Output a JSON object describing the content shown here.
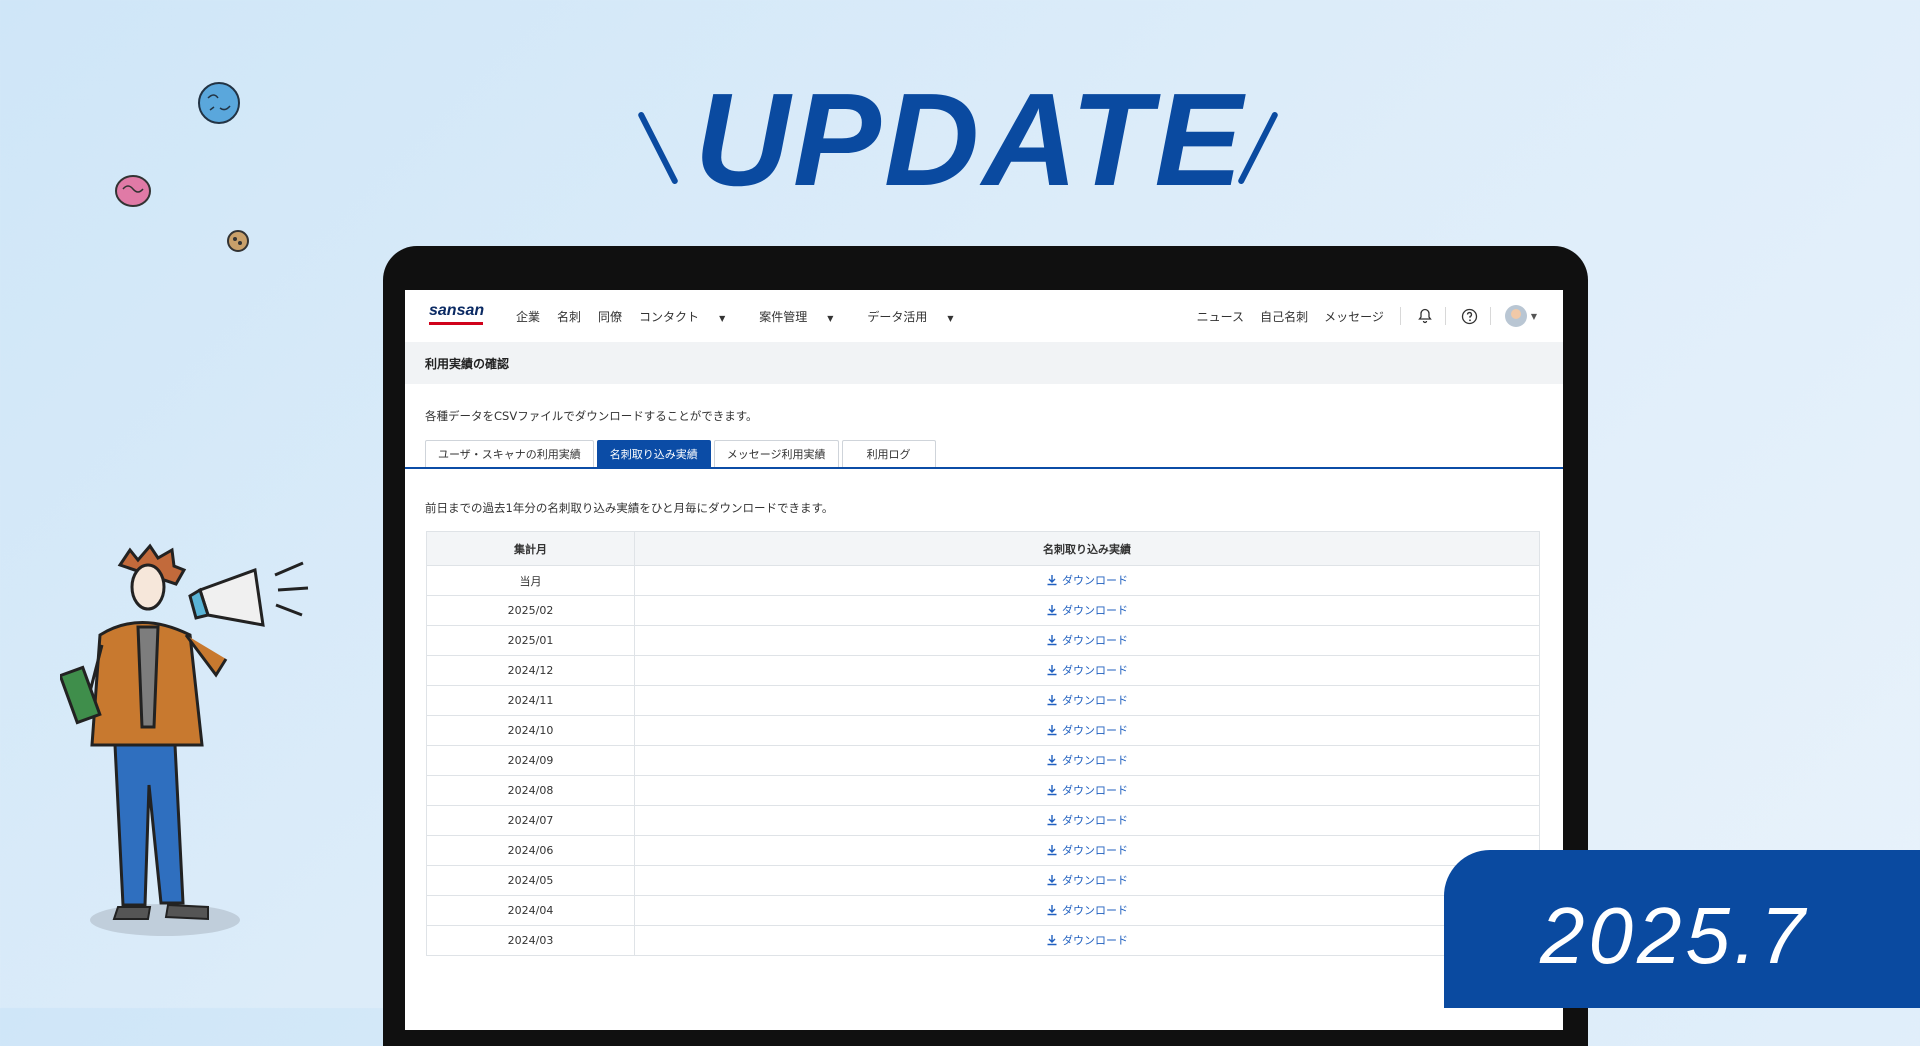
{
  "banner": {
    "headline": "UPDATE",
    "date": "2025.7"
  },
  "app": {
    "logo": "sansan",
    "nav": [
      "企業",
      "名刺",
      "同僚",
      "コンタクト",
      "案件管理",
      "データ活用"
    ],
    "right_nav": [
      "ニュース",
      "自己名刺",
      "メッセージ"
    ],
    "page_title": "利用実績の確認",
    "description": "各種データをCSVファイルでダウンロードすることができます。",
    "tabs": [
      {
        "label": "ユーザ・スキャナの利用実績",
        "active": false
      },
      {
        "label": "名刺取り込み実績",
        "active": true
      },
      {
        "label": "メッセージ利用実績",
        "active": false
      },
      {
        "label": "利用ログ",
        "active": false
      }
    ],
    "sub_description": "前日までの過去1年分の名刺取り込み実績をひと月毎にダウンロードできます。",
    "table": {
      "headers": [
        "集計月",
        "名刺取り込み実績"
      ],
      "rows": [
        {
          "month": "当月",
          "action": "ダウンロード"
        },
        {
          "month": "2025/02",
          "action": "ダウンロード"
        },
        {
          "month": "2025/01",
          "action": "ダウンロード"
        },
        {
          "month": "2024/12",
          "action": "ダウンロード"
        },
        {
          "month": "2024/11",
          "action": "ダウンロード"
        },
        {
          "month": "2024/10",
          "action": "ダウンロード"
        },
        {
          "month": "2024/09",
          "action": "ダウンロード"
        },
        {
          "month": "2024/08",
          "action": "ダウンロード"
        },
        {
          "month": "2024/07",
          "action": "ダウンロード"
        },
        {
          "month": "2024/06",
          "action": "ダウンロード"
        },
        {
          "month": "2024/05",
          "action": "ダウンロード"
        },
        {
          "month": "2024/04",
          "action": "ダウンロード"
        },
        {
          "month": "2024/03",
          "action": "ダウンロード"
        }
      ]
    }
  },
  "colors": {
    "brand_blue": "#0a4aa0",
    "tab_active": "#0b4ca6",
    "link": "#1f5fbf",
    "logo_red": "#d0021b"
  },
  "icons": [
    "bell-icon",
    "help-icon",
    "download-icon",
    "megaphone-icon"
  ]
}
